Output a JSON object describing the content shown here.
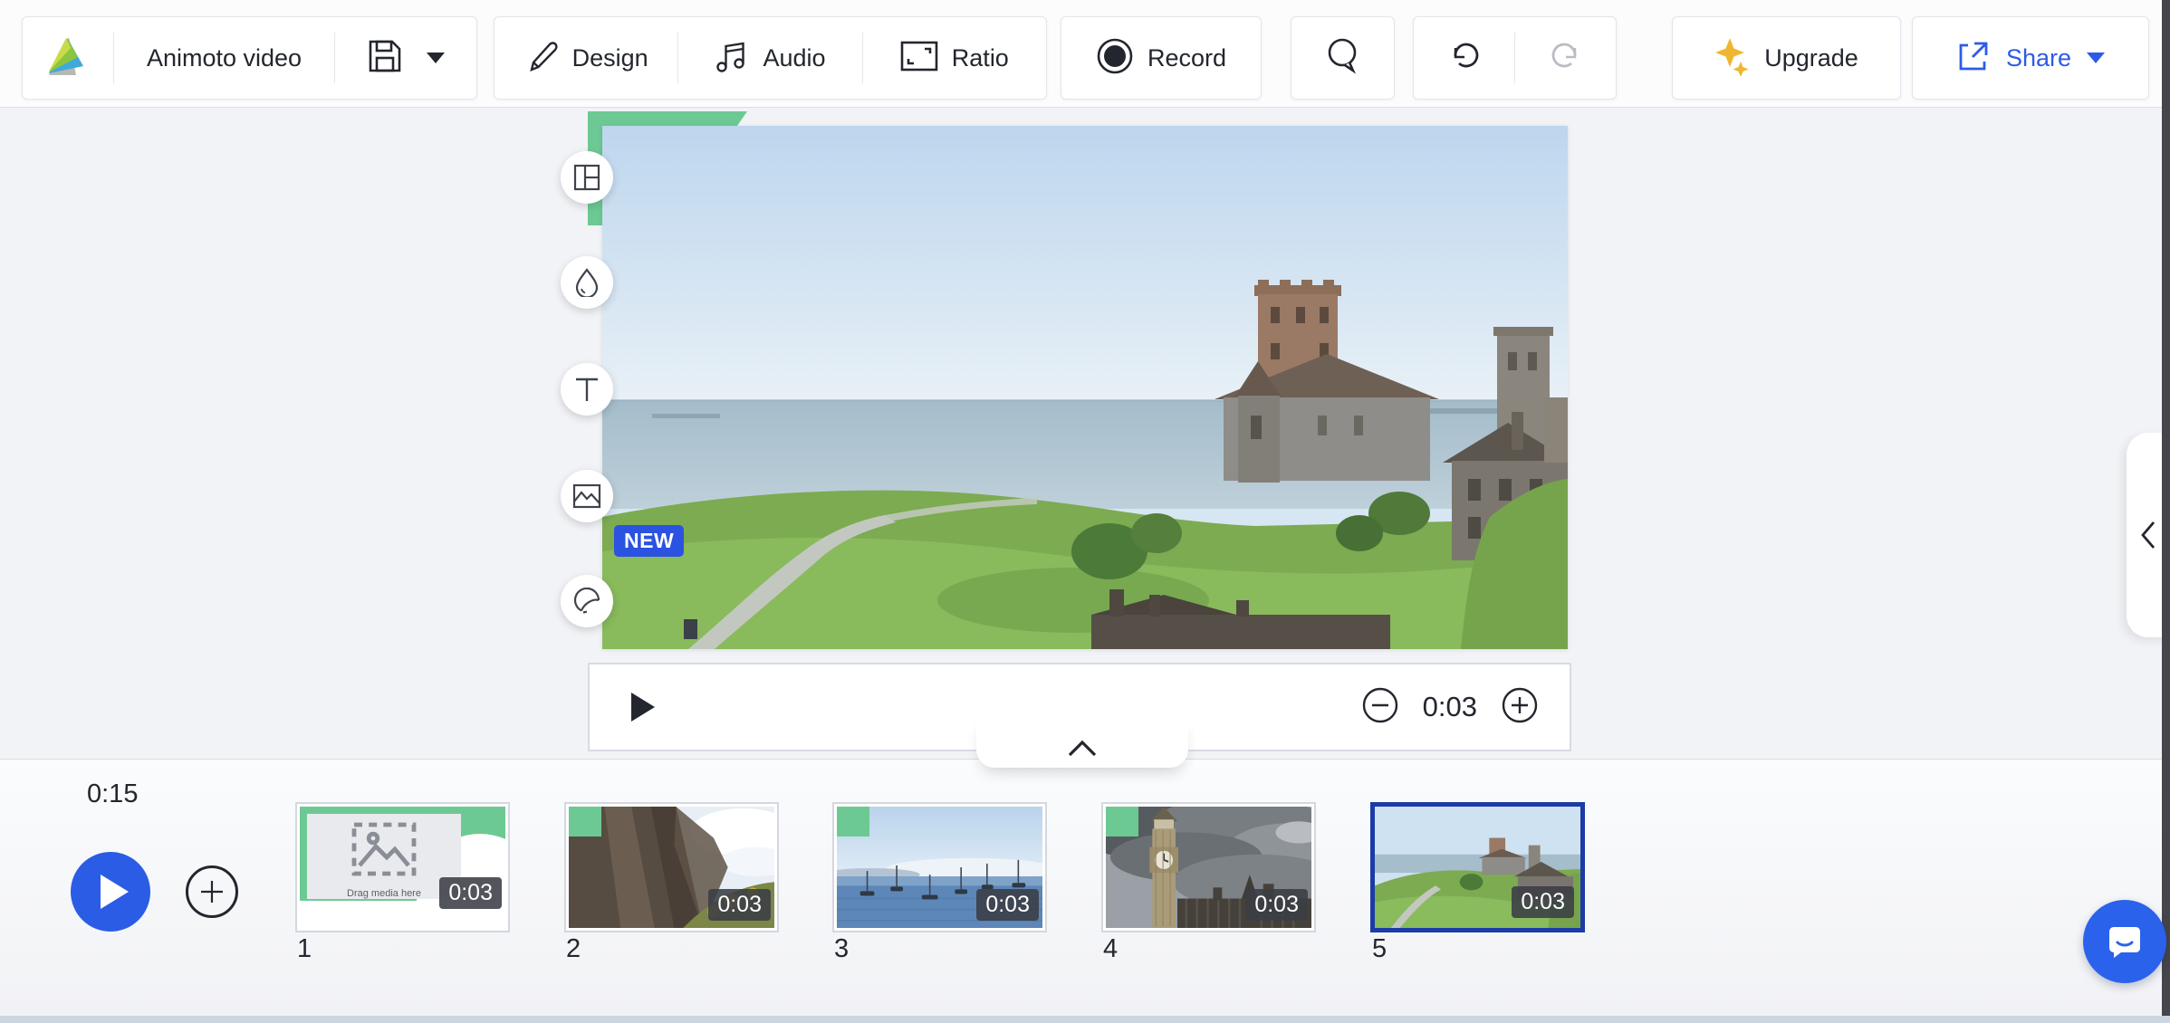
{
  "header": {
    "logo": "animoto-logo",
    "project_title": "Animoto video",
    "design_label": "Design",
    "audio_label": "Audio",
    "ratio_label": "Ratio",
    "record_label": "Record",
    "upgrade_label": "Upgrade",
    "share_label": "Share"
  },
  "canvas": {
    "new_badge_label": "NEW"
  },
  "player": {
    "scene_duration": "0:03"
  },
  "timeline": {
    "total_duration": "0:15",
    "blocks": [
      {
        "number": "1",
        "duration": "0:03",
        "placeholder_text": "Drag media here",
        "selected": false
      },
      {
        "number": "2",
        "duration": "0:03",
        "selected": false
      },
      {
        "number": "3",
        "duration": "0:03",
        "selected": false
      },
      {
        "number": "4",
        "duration": "0:03",
        "selected": false
      },
      {
        "number": "5",
        "duration": "0:03",
        "selected": true
      }
    ]
  },
  "icons": {
    "save": "floppy-disk",
    "search": "magnifier-bubble",
    "undo": "arrow-rotate-left",
    "redo": "arrow-rotate-right",
    "upgrade": "sparkles",
    "share": "box-arrow-out",
    "tools": [
      "layout",
      "color-drop",
      "text",
      "media",
      "sticker"
    ],
    "chat": "speech-bubble-smile"
  },
  "colors": {
    "accent_blue": "#2b5ce5",
    "brand_green": "#6dc993",
    "selected_border": "#1c3ba6",
    "upgrade_gold": "#efb631",
    "text_dark": "#23262e"
  }
}
